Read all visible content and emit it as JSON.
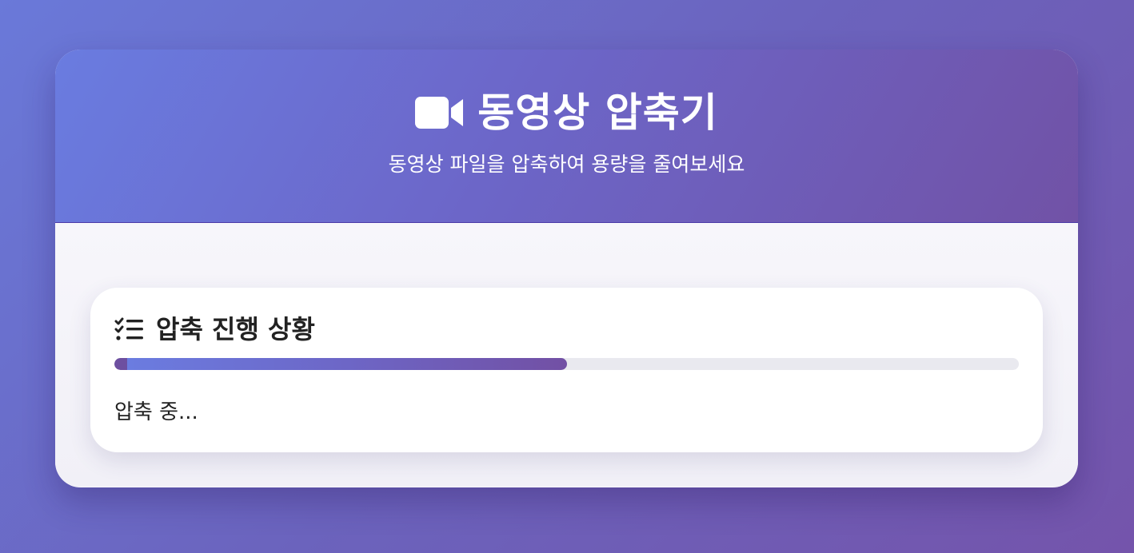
{
  "app": {
    "title": "동영상 압축기",
    "subtitle": "동영상 파일을 압축하여 용량을 줄여보세요",
    "title_icon": "video-camera-icon"
  },
  "progress": {
    "heading": "압축 진행 상황",
    "heading_icon": "task-list-icon",
    "percent": 50,
    "status": "압축 중..."
  },
  "colors": {
    "background_start": "#6a79d9",
    "background_end": "#7454ab",
    "accent_start": "#6b7ce0",
    "accent_end": "#7250a4",
    "track": "#e9e9ef"
  }
}
